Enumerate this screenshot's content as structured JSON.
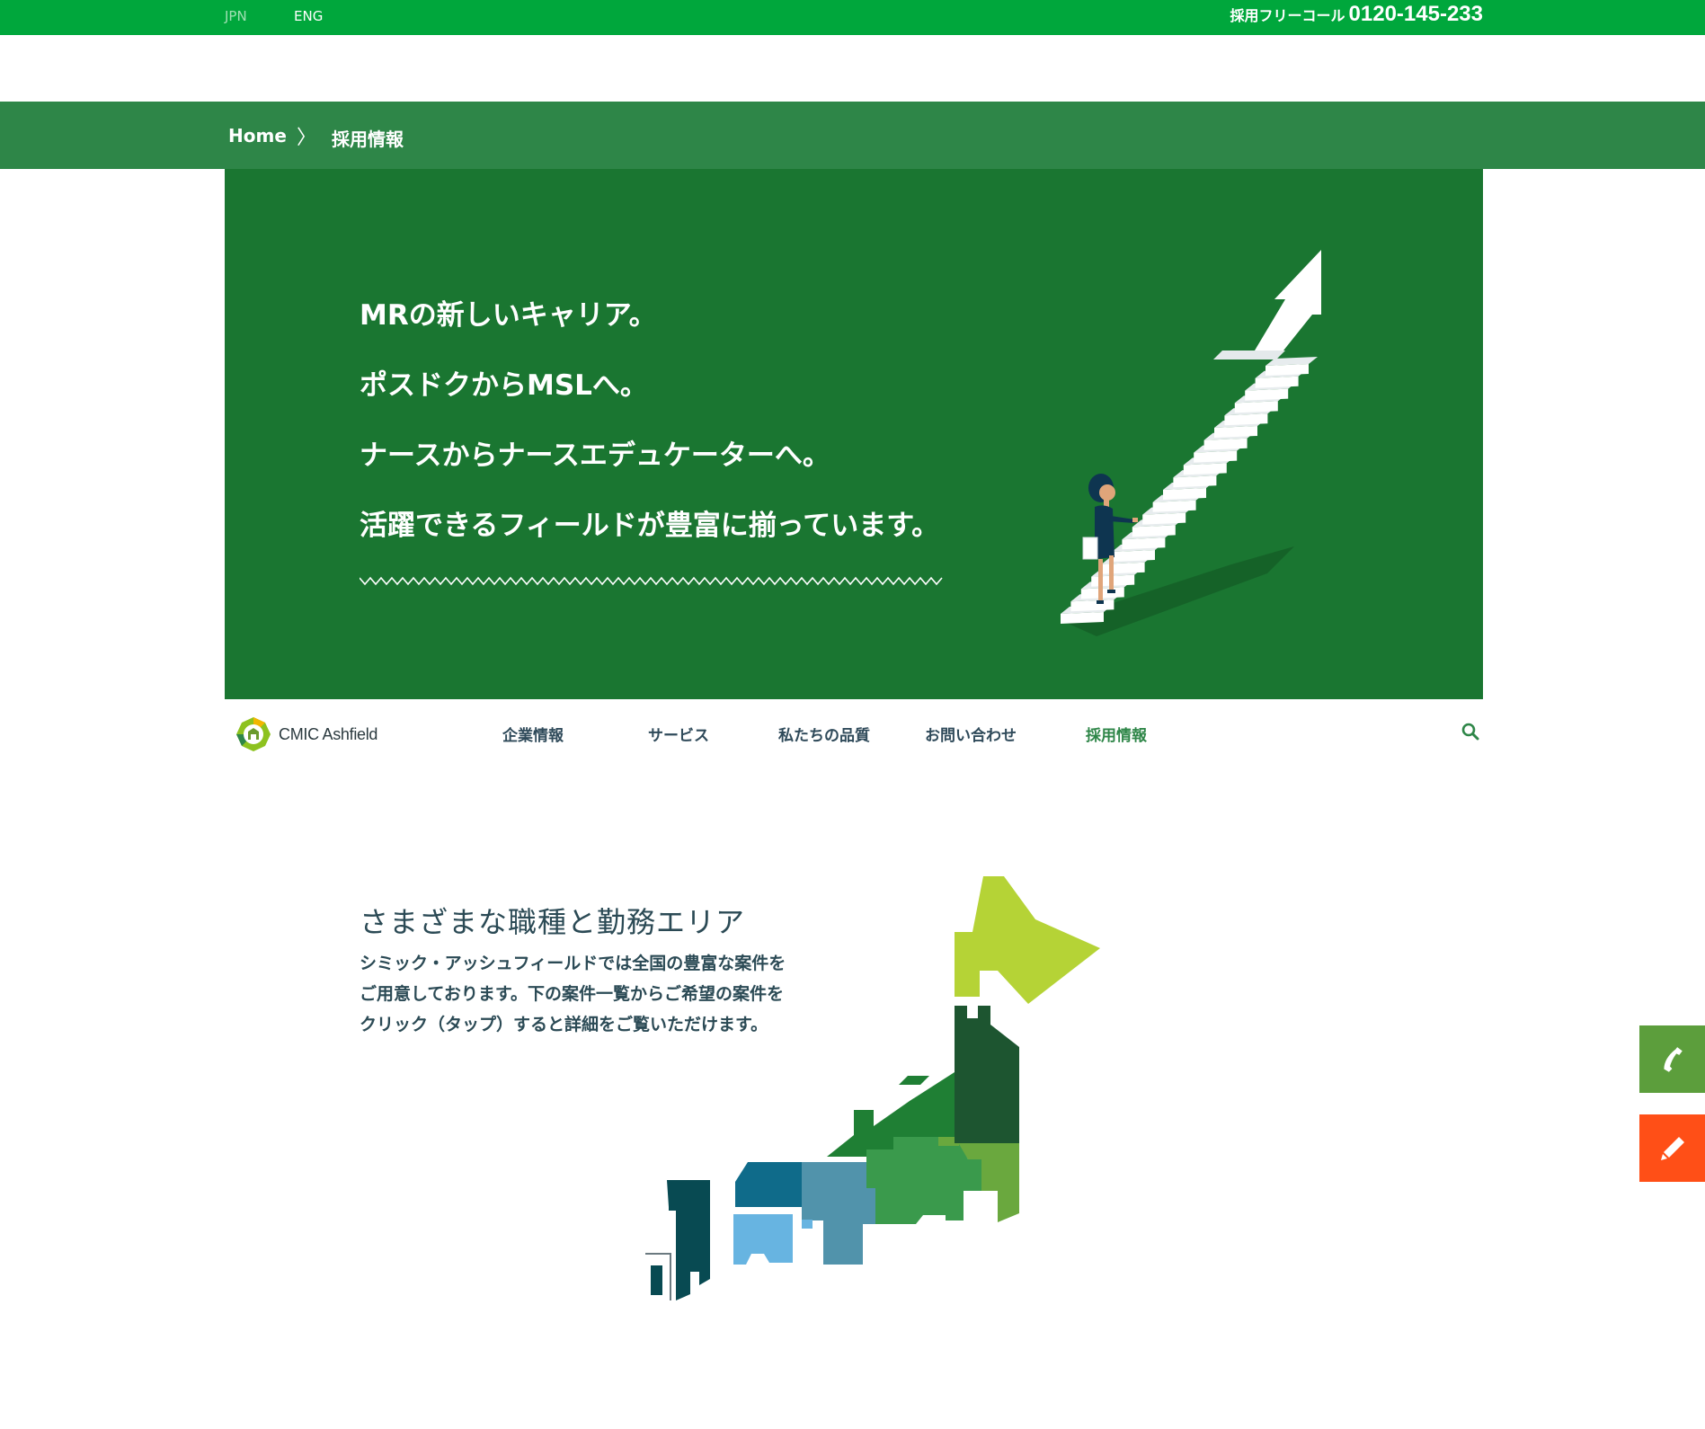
{
  "topbar": {
    "lang_jpn": "JPN",
    "lang_eng": "ENG",
    "freecall_label": "採用フリーコール",
    "freecall_number": "0120-145-233"
  },
  "breadcrumb": {
    "home": "Home",
    "separator": "〉",
    "current": "採用情報"
  },
  "hero": {
    "lines": [
      "MRの新しいキャリア。",
      "ポスドクからMSLへ。",
      "ナースからナースエデュケーターへ。",
      "活躍できるフィールドが豊富に揃っています。"
    ]
  },
  "nav": {
    "logo_text": "CMIC Ashfield",
    "items": [
      "企業情報",
      "サービス",
      "私たちの品質",
      "お問い合わせ",
      "採用情報"
    ],
    "active_item": "採用情報"
  },
  "section": {
    "title": "さまざまな職種と勤務エリア",
    "body": "シミック・アッシュフィールドでは全国の豊富な案件をご用意しております。下の案件一覧からご希望の案件をクリック（タップ）すると詳細をご覧いただけます。"
  },
  "icons": {
    "search": "search-icon",
    "phone": "phone-icon",
    "pencil": "pencil-icon",
    "logo": "cmic-ashfield-logo",
    "chevron": "chevron-right-icon"
  },
  "colors": {
    "topbar": "#00a73c",
    "breadcrumb_bar": "#2e8648",
    "hero_bg": "#1a7631",
    "nav_active": "#2e8648",
    "tel_button": "#5c9e3c",
    "mail_button": "#ff4f17"
  }
}
